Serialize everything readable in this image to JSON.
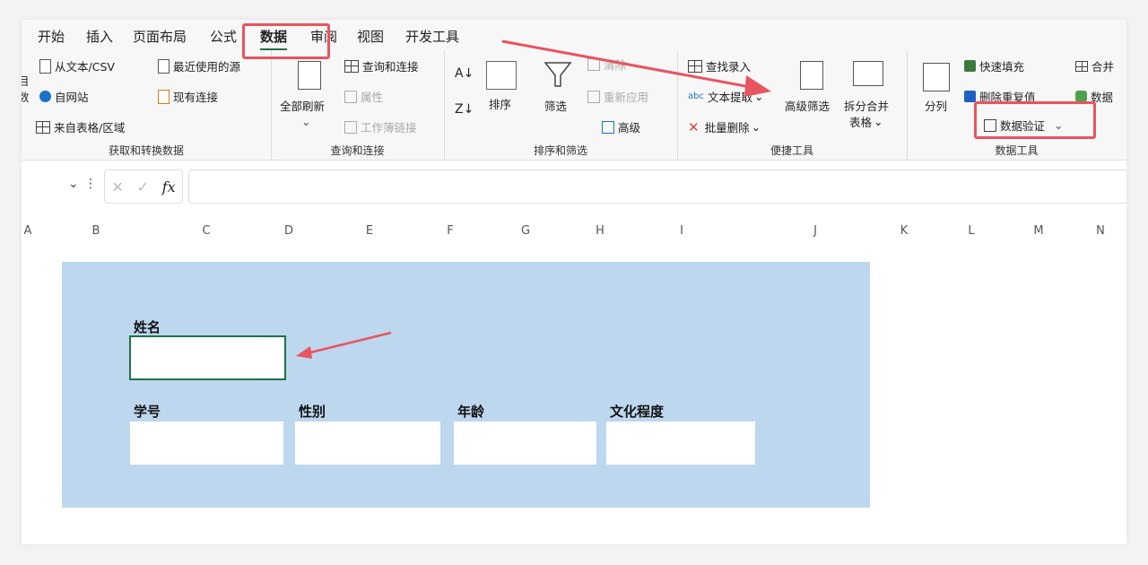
{
  "tabs": [
    "开始",
    "插入",
    "页面布局",
    "公式",
    "数据",
    "审阅",
    "视图",
    "开发工具"
  ],
  "active_tab": "数据",
  "ribbon": {
    "get_transform": {
      "label": "获取和转换数据",
      "left_partial": [
        "目",
        "数"
      ],
      "items": {
        "from_csv": "从文本/CSV",
        "recent_sources": "最近使用的源",
        "from_web": "自网站",
        "existing_conn": "现有连接",
        "from_table": "来自表格/区域"
      }
    },
    "query_conn": {
      "label": "查询和连接",
      "refresh_all": "全部刷新",
      "items": {
        "queries": "查询和连接",
        "properties": "属性",
        "workbook_links": "工作簿链接"
      }
    },
    "sort_filter": {
      "label": "排序和筛选",
      "sort": "排序",
      "filter": "筛选",
      "clear": "清除",
      "reapply": "重新应用",
      "advanced": "高级"
    },
    "quick_tools": {
      "label": "便捷工具",
      "lookup_entry": "查找录入",
      "text_extract": "文本提取",
      "batch_delete": "批量删除",
      "adv_filter": "高级筛选",
      "split_merge": "拆分合并",
      "split_merge_2": "表格"
    },
    "data_tools": {
      "label": "数据工具",
      "split_column": "分列",
      "flash_fill": "快速填充",
      "remove_dup": "删除重复值",
      "data_validation": "数据验证",
      "merge_partial": "合并",
      "data_partial": "数据"
    }
  },
  "formula_bar": {
    "fx": "fx",
    "value": ""
  },
  "columns": [
    "A",
    "B",
    "C",
    "D",
    "E",
    "F",
    "G",
    "H",
    "I",
    "J",
    "K",
    "L",
    "M",
    "N"
  ],
  "form": {
    "name_label": "姓名",
    "id_label": "学号",
    "gender_label": "性别",
    "age_label": "年龄",
    "education_label": "文化程度"
  },
  "colors": {
    "accent": "#1e7145",
    "highlight": "#e8545f",
    "form_bg": "#bdd7ee"
  }
}
